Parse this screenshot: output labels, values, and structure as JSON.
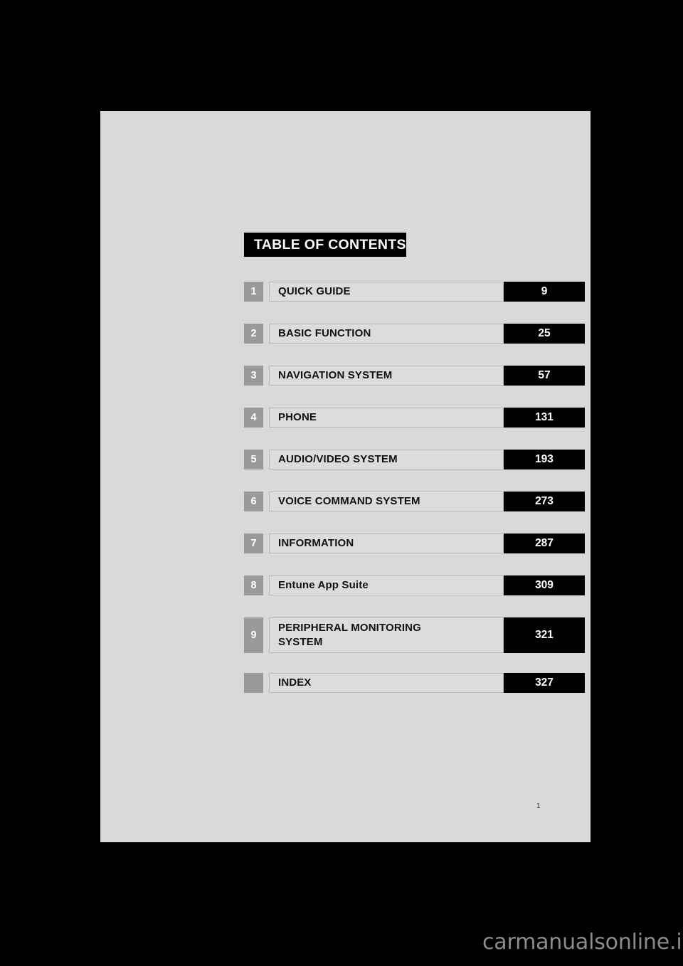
{
  "document": {
    "title": "TABLE OF CONTENTS",
    "folio": "1",
    "watermark": "carmanualsonline.info"
  },
  "colors": {
    "canvas": "#000000",
    "page": "#d9d9d9",
    "number_box": "#9a9a9a",
    "label_box": "#dcdcdc",
    "label_border": "#b9b9b9",
    "page_box": "#000000",
    "text_dark": "#111111",
    "text_light": "#ffffff"
  },
  "toc": {
    "rows": [
      {
        "number": "1",
        "label": "QUICK GUIDE",
        "page": "9"
      },
      {
        "number": "2",
        "label": "BASIC FUNCTION",
        "page": "25"
      },
      {
        "number": "3",
        "label": "NAVIGATION SYSTEM",
        "page": "57"
      },
      {
        "number": "4",
        "label": "PHONE",
        "page": "131"
      },
      {
        "number": "5",
        "label": "AUDIO/VIDEO SYSTEM",
        "page": "193"
      },
      {
        "number": "6",
        "label": "VOICE COMMAND SYSTEM",
        "page": "273"
      },
      {
        "number": "7",
        "label": "INFORMATION",
        "page": "287"
      },
      {
        "number": "8",
        "label": "Entune App Suite",
        "page": "309"
      },
      {
        "number": "9",
        "label": "PERIPHERAL MONITORING\nSYSTEM",
        "page": "321"
      },
      {
        "number": "",
        "label": "INDEX",
        "page": "327"
      }
    ]
  }
}
